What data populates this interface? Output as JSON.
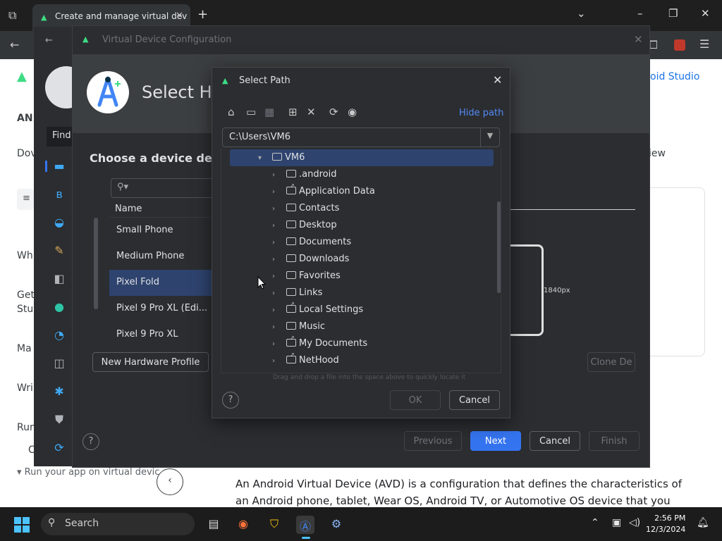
{
  "browser": {
    "tab_title": "Create and manage virtual dev",
    "tab_close": "✕",
    "new_tab": "+",
    "window_chevron": "⌄",
    "window_min": "–",
    "window_max": "❐",
    "window_close": "✕"
  },
  "page": {
    "brand": "oid Studio",
    "side_labels": [
      "AN",
      "Dov",
      "Wh",
      "Get",
      "Stu",
      "Ma",
      "Wri",
      "Run",
      "C"
    ],
    "find_label": "Find",
    "view_label": "iew",
    "breadcrumb_bottom": "Run your app on virtual devic",
    "paragraph_line1": "An Android Virtual Device (AVD) is a configuration that defines the characteristics of",
    "paragraph_line2": "an Android phone, tablet, Wear OS, Android TV, or Automotive OS device that you"
  },
  "vdc": {
    "title": "Virtual Device Configuration",
    "heading": "Select Ha",
    "subheading": "Choose a device def",
    "search_placeholder": "",
    "column_name": "Name",
    "devices": [
      {
        "label": "Small Phone"
      },
      {
        "label": "Medium Phone"
      },
      {
        "label": "Pixel Fold"
      },
      {
        "label": "Pixel 9 Pro XL (Edi..."
      },
      {
        "label": "Pixel 9 Pro XL"
      }
    ],
    "new_hardware_profile": "New Hardware Profile",
    "clone_label": "Clone De",
    "dimension_label": "1840px",
    "previous": "Previous",
    "next": "Next",
    "cancel": "Cancel",
    "finish": "Finish",
    "help": "?"
  },
  "dialog": {
    "title": "Select Path",
    "hide_path": "Hide path",
    "path_value": "C:\\Users\\VM6",
    "root": "VM6",
    "items": [
      {
        "label": ".android",
        "link": false
      },
      {
        "label": "Application Data",
        "link": true
      },
      {
        "label": "Contacts",
        "link": false
      },
      {
        "label": "Desktop",
        "link": false
      },
      {
        "label": "Documents",
        "link": false
      },
      {
        "label": "Downloads",
        "link": false
      },
      {
        "label": "Favorites",
        "link": false
      },
      {
        "label": "Links",
        "link": false
      },
      {
        "label": "Local Settings",
        "link": true
      },
      {
        "label": "Music",
        "link": false
      },
      {
        "label": "My Documents",
        "link": true
      },
      {
        "label": "NetHood",
        "link": true
      }
    ],
    "hint": "Drag and drop a file into the space above to quickly locate it",
    "ok": "OK",
    "cancel": "Cancel",
    "help": "?"
  },
  "taskbar": {
    "search_label": "Search",
    "time": "2:56 PM",
    "date": "12/3/2024"
  }
}
